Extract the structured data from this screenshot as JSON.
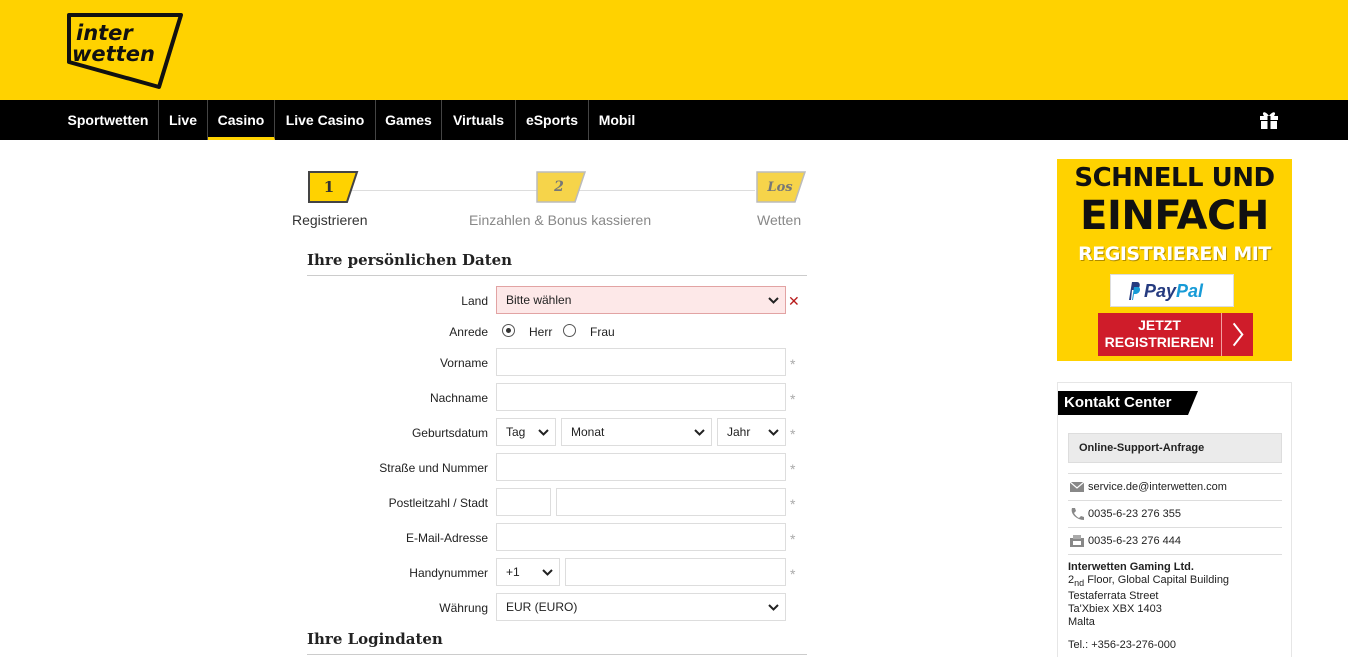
{
  "brand": {
    "logo_line1": "inter",
    "logo_line2": "wetten",
    "yellow": "#ffd200",
    "nav_bg": "#000000"
  },
  "nav": {
    "items": [
      {
        "label": "Sportwetten"
      },
      {
        "label": "Live"
      },
      {
        "label": "Casino",
        "active": true
      },
      {
        "label": "Live Casino"
      },
      {
        "label": "Games"
      },
      {
        "label": "Virtuals"
      },
      {
        "label": "eSports"
      },
      {
        "label": "Mobil"
      }
    ],
    "gift_icon": "gift-icon"
  },
  "steps": [
    {
      "number": "1",
      "label": "Registrieren"
    },
    {
      "number": "2",
      "label": "Einzahlen & Bonus kassieren"
    },
    {
      "number": "Los",
      "label": "Wetten"
    }
  ],
  "form": {
    "section_personal": "Ihre persönlichen Daten",
    "land_label": "Land",
    "land_value": "Bitte wählen",
    "anrede_label": "Anrede",
    "anrede_herr": "Herr",
    "anrede_frau": "Frau",
    "vorname_label": "Vorname",
    "nachname_label": "Nachname",
    "geburtsdatum_label": "Geburtsdatum",
    "tag": "Tag",
    "monat": "Monat",
    "jahr": "Jahr",
    "strasse_label": "Straße und Nummer",
    "plz_label": "Postleitzahl / Stadt",
    "email_label": "E-Mail-Adresse",
    "handy_label": "Handynummer",
    "handy_prefix": "+1",
    "waehrung_label": "Währung",
    "waehrung_value": "EUR (EURO)",
    "required_mark": "*",
    "error_mark": "✕",
    "section_login": "Ihre Logindaten"
  },
  "promo": {
    "line1": "SCHNELL UND",
    "line2": "EINFACH",
    "line3": "REGISTRIEREN MIT",
    "paypal_1": "Pay",
    "paypal_2": "Pal",
    "button_line1": "JETZT",
    "button_line2": "REGISTRIEREN!"
  },
  "contact": {
    "title": "Kontakt Center",
    "support": "Online-Support-Anfrage",
    "email": "service.de@interwetten.com",
    "phone": "0035-6-23 276 355",
    "fax": "0035-6-23 276 444",
    "company": "Interwetten Gaming Ltd.",
    "addr_floor_num": "2",
    "addr_floor_sup": "nd",
    "addr_floor_rest": " Floor, Global Capital Building",
    "addr_street": "Testaferrata Street",
    "addr_city": "Ta'Xbiex XBX 1403",
    "addr_country": "Malta",
    "tel": "Tel.: +356-23-276-000"
  }
}
